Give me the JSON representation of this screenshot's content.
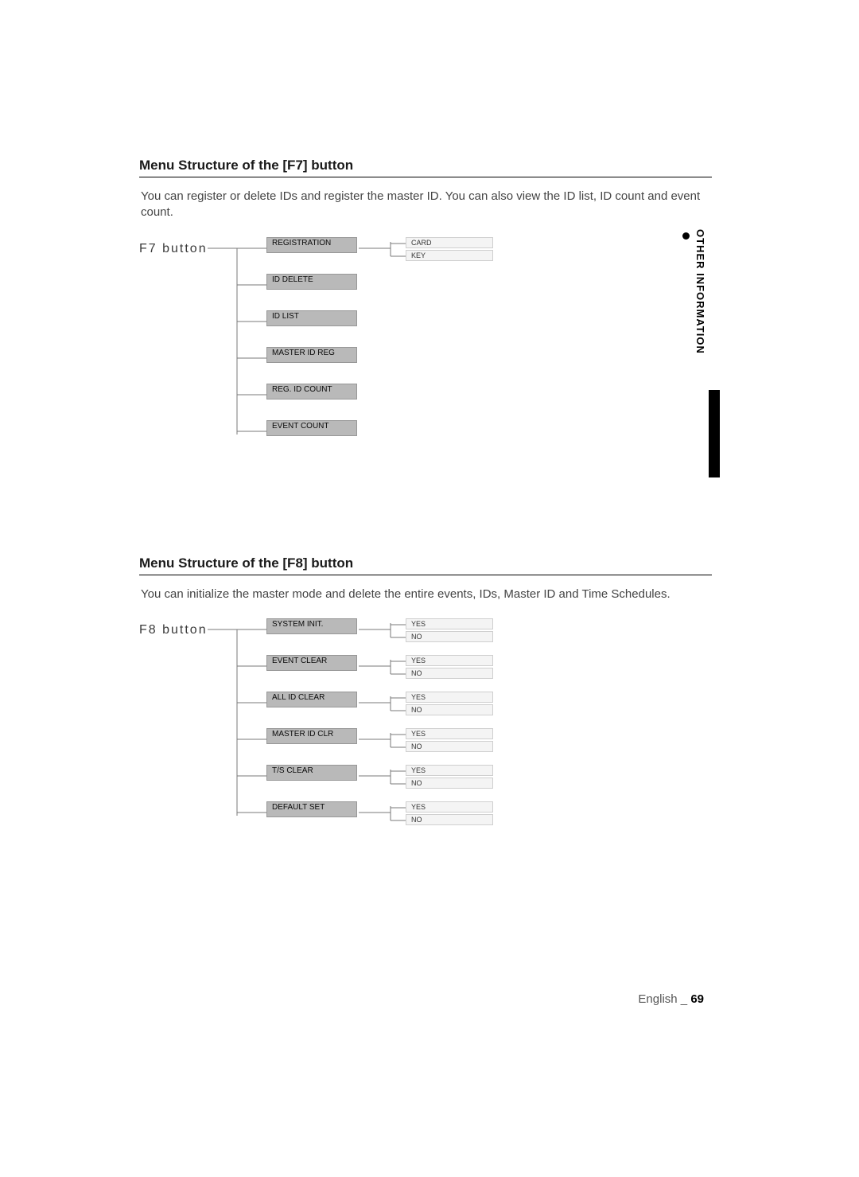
{
  "side_tab": "OTHER INFORMATION",
  "sections": {
    "f7": {
      "title": "Menu Structure of the [F7] button",
      "desc": "You can register or delete IDs and register the master ID. You can also view the ID list, ID count and event count.",
      "root": "F7 button",
      "items": [
        {
          "label": "REGISTRATION",
          "leaves": [
            "CARD",
            "KEY"
          ]
        },
        {
          "label": "ID DELETE"
        },
        {
          "label": "ID LIST"
        },
        {
          "label": "MASTER ID REG"
        },
        {
          "label": "REG. ID COUNT"
        },
        {
          "label": "EVENT COUNT"
        }
      ]
    },
    "f8": {
      "title": "Menu Structure of the [F8] button",
      "desc": "You can initialize the master mode and delete the entire events, IDs, Master ID and Time Schedules.",
      "root": "F8 button",
      "items": [
        {
          "label": "SYSTEM INIT.",
          "leaves": [
            "YES",
            "NO"
          ]
        },
        {
          "label": "EVENT CLEAR",
          "leaves": [
            "YES",
            "NO"
          ]
        },
        {
          "label": "ALL ID CLEAR",
          "leaves": [
            "YES",
            "NO"
          ]
        },
        {
          "label": "MASTER ID CLR",
          "leaves": [
            "YES",
            "NO"
          ]
        },
        {
          "label": "T/S CLEAR",
          "leaves": [
            "YES",
            "NO"
          ]
        },
        {
          "label": "DEFAULT SET",
          "leaves": [
            "YES",
            "NO"
          ]
        }
      ]
    }
  },
  "footer": {
    "lang": "English",
    "sep": " _ ",
    "page": "69"
  }
}
